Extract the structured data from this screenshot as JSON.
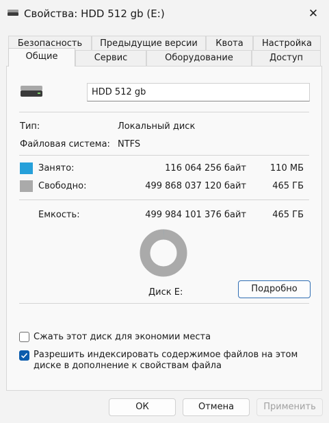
{
  "window": {
    "title": "Свойства: HDD 512 gb (E:)",
    "close_glyph": "✕"
  },
  "tabs_top": [
    "Безопасность",
    "Предыдущие версии",
    "Квота",
    "Настройка"
  ],
  "tabs_bottom": [
    "Общие",
    "Сервис",
    "Оборудование",
    "Доступ"
  ],
  "active_tab": "Общие",
  "general": {
    "drive_name": "HDD 512 gb",
    "type_label": "Тип:",
    "type_value": "Локальный диск",
    "fs_label": "Файловая система:",
    "fs_value": "NTFS",
    "used_label": "Занято:",
    "used_bytes": "116 064 256 байт",
    "used_short": "110 МБ",
    "free_label": "Свободно:",
    "free_bytes": "499 868 037 120 байт",
    "free_short": "465 ГБ",
    "capacity_label": "Емкость:",
    "capacity_bytes": "499 984 101 376 байт",
    "capacity_short": "465 ГБ",
    "disk_label": "Диск E:",
    "details_button": "Подробно",
    "used_color": "#26a0da",
    "free_color": "#aaaaaa",
    "used_fraction": 0.000232
  },
  "options": {
    "compress_label": "Сжать этот диск для экономии места",
    "compress_checked": false,
    "index_label_line1": "Разрешить индексировать содержимое файлов на этом",
    "index_label_line2": "диске в дополнение к свойствам файла",
    "index_checked": true
  },
  "footer": {
    "ok": "ОК",
    "cancel": "Отмена",
    "apply": "Применить"
  }
}
